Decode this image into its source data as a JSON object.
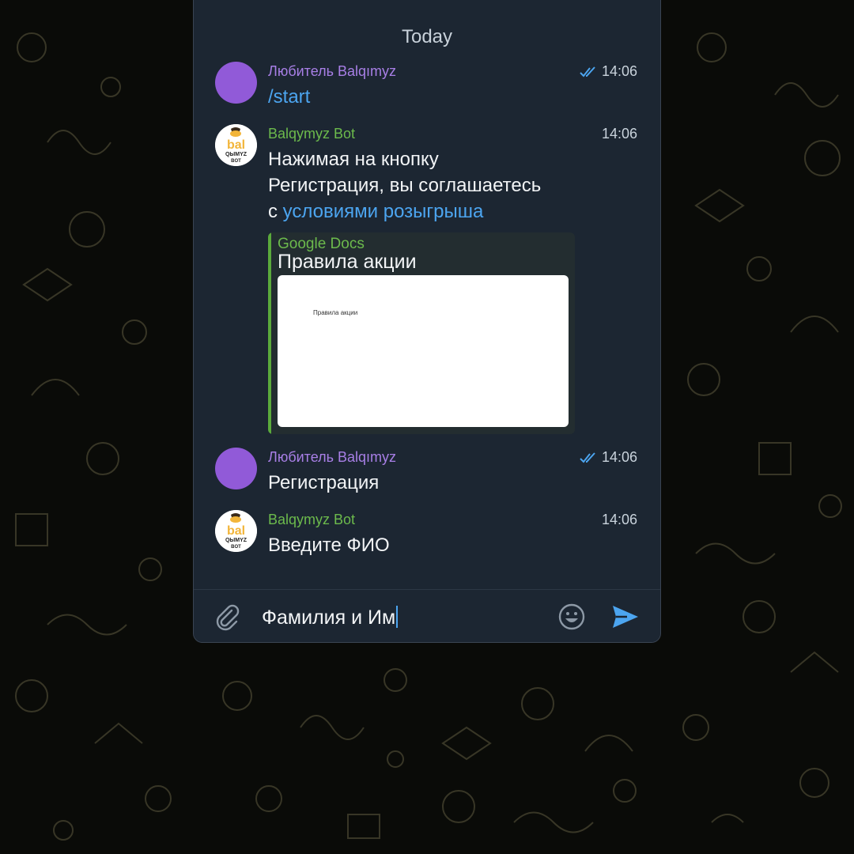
{
  "chat": {
    "date_separator": "Today",
    "messages": [
      {
        "author": "Любитель Balqımyz",
        "time": "14:06",
        "text": "/start",
        "read": true
      },
      {
        "author": "Balqymyz Bot",
        "time": "14:06",
        "text_lines": [
          "Нажимая на кнопку",
          "Регистрация, вы соглашаетесь"
        ],
        "text_prefix": "с ",
        "link_text": "условиями розыгрыша",
        "preview": {
          "site": "Google Docs",
          "title": "Правила акции",
          "image_text": "Правила акции"
        }
      },
      {
        "author": "Любитель Balqımyz",
        "time": "14:06",
        "text": "Регистрация",
        "read": true
      },
      {
        "author": "Balqymyz Bot",
        "time": "14:06",
        "text": "Введите ФИО"
      }
    ]
  },
  "bot_avatar": {
    "line1": "bal",
    "line2": "QЫMYZ",
    "line3": "BOT"
  },
  "composer": {
    "input_value": "Фамилия и Им"
  },
  "icons": {
    "attach": "paperclip-icon",
    "emoji": "smiley-icon",
    "send": "send-arrow-icon",
    "read_receipt": "double-check-icon"
  },
  "colors": {
    "user_author": "#a87fe6",
    "bot_author": "#6cba4c",
    "link": "#4ca5f0",
    "panel": "#1c2632",
    "user_avatar": "#915ad8"
  }
}
